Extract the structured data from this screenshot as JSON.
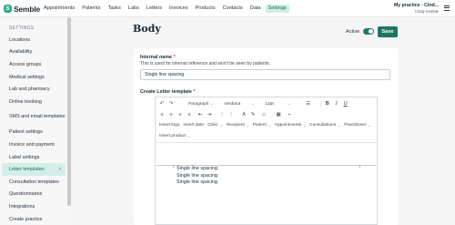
{
  "brand": {
    "name": "Semble",
    "color": "#2eaa8e"
  },
  "nav": {
    "items": [
      "Appointments",
      "Patients",
      "Tasks",
      "Labs",
      "Letters",
      "Invoices",
      "Products",
      "Contacts",
      "Data",
      "Settings"
    ],
    "active": "Settings"
  },
  "account": {
    "practice": "My practice - Cind...",
    "user": "Cindy Semble"
  },
  "sidebar": {
    "title": "SETTINGS",
    "items": [
      {
        "label": "Locations"
      },
      {
        "label": "Availability"
      },
      {
        "label": "Access groups"
      },
      {
        "label": "Medical settings"
      },
      {
        "label": "Lab and pharmacy"
      },
      {
        "label": "Online booking"
      },
      {
        "label": "SMS and email templates"
      },
      {
        "label": "Patient settings"
      },
      {
        "label": "Invoice and payment"
      },
      {
        "label": "Label settings"
      },
      {
        "label": "Letter templates",
        "active": true
      },
      {
        "label": "Consultation templates"
      },
      {
        "label": "Questionnaires"
      },
      {
        "label": "Integrations"
      },
      {
        "label": "Create practice"
      }
    ]
  },
  "page": {
    "title": "Body",
    "active_label": "Active",
    "active_on": true,
    "save_label": "Save"
  },
  "form": {
    "internal_name_label": "Internal name",
    "required_mark": "*",
    "internal_name_help": "This is used for internal reference and won't be seen by patients.",
    "internal_name_value": "Single line spacing",
    "create_label": "Create Letter template"
  },
  "toolbar": {
    "paragraph": "Paragraph",
    "font": "Verdana",
    "size": "12pt",
    "insert_logo": "Insert logo",
    "insert_date": "Insert date",
    "clinic": "Clinic",
    "recipient": "Recipient",
    "patient": "Patient",
    "appointments": "Appointments",
    "consultations": "Consultations",
    "practitioner": "Practitioner",
    "insert_product": "Insert product"
  },
  "editor": {
    "lines": [
      "Single line spacing",
      "Single line spacing",
      "Single line spacing"
    ]
  }
}
